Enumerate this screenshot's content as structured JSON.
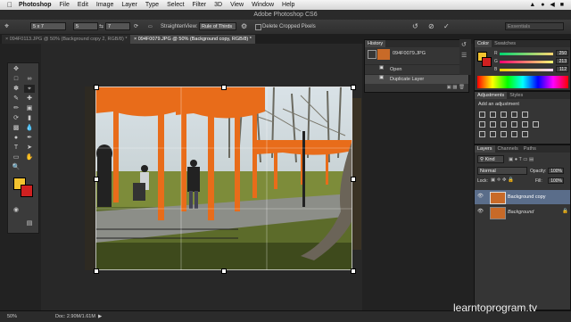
{
  "menubar": {
    "app_name": "Photoshop",
    "items": [
      "File",
      "Edit",
      "Image",
      "Layer",
      "Type",
      "Select",
      "Filter",
      "3D",
      "View",
      "Window",
      "Help"
    ]
  },
  "title": "Adobe Photoshop CS6",
  "options": {
    "ratio": "5 x 7",
    "width": "5",
    "height": "7",
    "straighten": "Straighten",
    "view_label": "View:",
    "view_value": "Rule of Thirds",
    "delete_pixels": "Delete Cropped Pixels",
    "workspace": "Essentials"
  },
  "tabs": [
    {
      "label": "094F0113.JPG @ 50% (Background copy 2, RGB/8) *"
    },
    {
      "label": "094F0079.JPG @ 50% (Background copy, RGB/8) *"
    }
  ],
  "history": {
    "title": "History",
    "snapshot": "094F0079.JPG",
    "items": [
      "Open",
      "Duplicate Layer"
    ]
  },
  "color": {
    "tabs": [
      "Color",
      "Swatches"
    ],
    "r": "250",
    "g": "213",
    "b": "112",
    "fg": "#f3c32f",
    "bg": "#d02020"
  },
  "adjustments": {
    "tabs": [
      "Adjustments",
      "Styles"
    ],
    "prompt": "Add an adjustment"
  },
  "layers": {
    "tabs": [
      "Layers",
      "Channels",
      "Paths"
    ],
    "kind": "Kind",
    "blend": "Normal",
    "opacity_label": "Opacity:",
    "opacity": "100%",
    "lock_label": "Lock:",
    "fill_label": "Fill:",
    "fill": "100%",
    "items": [
      "Background copy",
      "Background"
    ]
  },
  "status": {
    "zoom": "50%",
    "doc": "Doc: 2.90M/1.61M"
  },
  "watermark": "learntoprogram.tv"
}
